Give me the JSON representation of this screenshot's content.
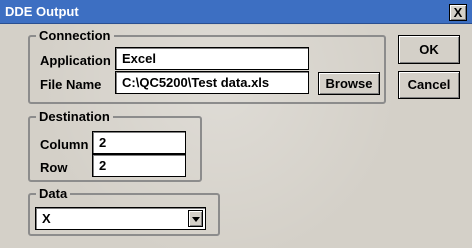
{
  "window": {
    "title": "DDE Output",
    "close_label": "X"
  },
  "connection": {
    "legend": "Connection",
    "application_label": "Application",
    "application_value": "Excel",
    "file_label": "File Name",
    "file_value": "C:\\QC5200\\Test data.xls",
    "browse_label": "Browse"
  },
  "destination": {
    "legend": "Destination",
    "column_label": "Column",
    "column_value": "2",
    "row_label": "Row",
    "row_value": "2"
  },
  "data_group": {
    "legend": "Data",
    "selected": "X"
  },
  "buttons": {
    "ok_label": "OK",
    "cancel_label": "Cancel"
  }
}
